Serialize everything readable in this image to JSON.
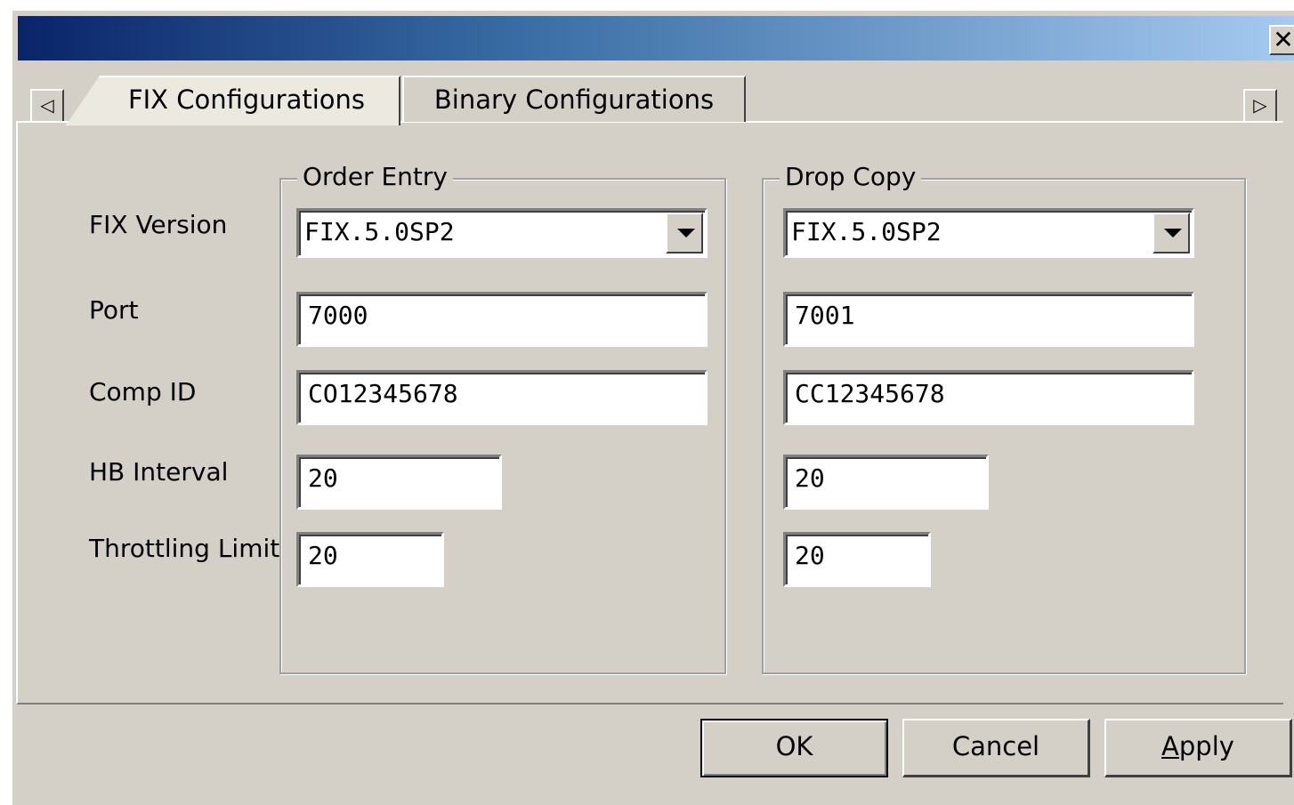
{
  "window": {
    "title": "",
    "close_glyph": "✕"
  },
  "tabs": [
    {
      "label": "FIX Configurations",
      "active": true
    },
    {
      "label": "Binary Configurations",
      "active": false
    }
  ],
  "scroll": {
    "left_glyph": "◁",
    "right_glyph": "▷"
  },
  "labels": {
    "fix_version": "FIX Version",
    "port": "Port",
    "comp_id": "Comp ID",
    "hb_interval": "HB Interval",
    "throttling_limit": "Throttling Limit"
  },
  "order_entry": {
    "title": "Order Entry",
    "fix_version": "FIX.5.0SP2",
    "port": "7000",
    "comp_id": "CO12345678",
    "hb_interval": "20",
    "throttling_limit": "20"
  },
  "drop_copy": {
    "title": "Drop Copy",
    "fix_version": "FIX.5.0SP2",
    "port": "7001",
    "comp_id": "CC12345678",
    "hb_interval": "20",
    "throttling_limit": "20"
  },
  "buttons": {
    "ok": "OK",
    "cancel": "Cancel",
    "apply_first": "A",
    "apply_rest": "pply"
  }
}
